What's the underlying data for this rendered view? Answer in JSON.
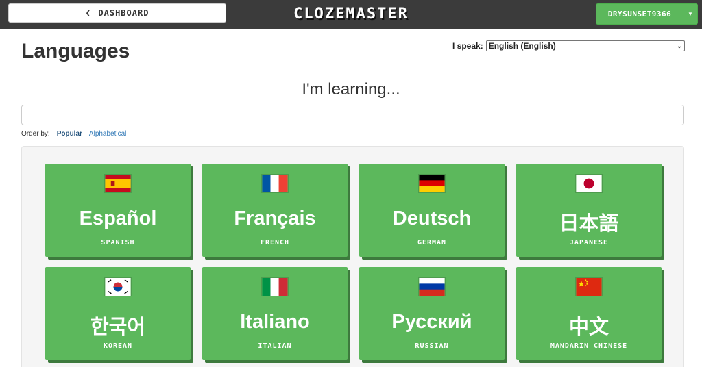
{
  "header": {
    "dashboard_label": "DASHBOARD",
    "logo": "CLOZEMASTER",
    "username": "DRYSUNSET9366"
  },
  "page": {
    "title": "Languages",
    "speak_label": "I speak:",
    "speak_value": "English (English)",
    "learning_heading": "I'm learning...",
    "search_value": "",
    "order_label": "Order by:",
    "order_options": [
      "Popular",
      "Alphabetical"
    ],
    "order_selected": "Popular"
  },
  "colors": {
    "card": "#5cb85c",
    "header": "#3b3b3b"
  },
  "languages": [
    {
      "native": "Español",
      "english": "SPANISH",
      "flag": "spain-flag-icon"
    },
    {
      "native": "Français",
      "english": "FRENCH",
      "flag": "france-flag-icon"
    },
    {
      "native": "Deutsch",
      "english": "GERMAN",
      "flag": "germany-flag-icon"
    },
    {
      "native": "日本語",
      "english": "JAPANESE",
      "flag": "japan-flag-icon"
    },
    {
      "native": "한국어",
      "english": "KOREAN",
      "flag": "korea-flag-icon"
    },
    {
      "native": "Italiano",
      "english": "ITALIAN",
      "flag": "italy-flag-icon"
    },
    {
      "native": "Русский",
      "english": "RUSSIAN",
      "flag": "russia-flag-icon"
    },
    {
      "native": "中文",
      "english": "MANDARIN CHINESE",
      "flag": "china-flag-icon"
    }
  ]
}
